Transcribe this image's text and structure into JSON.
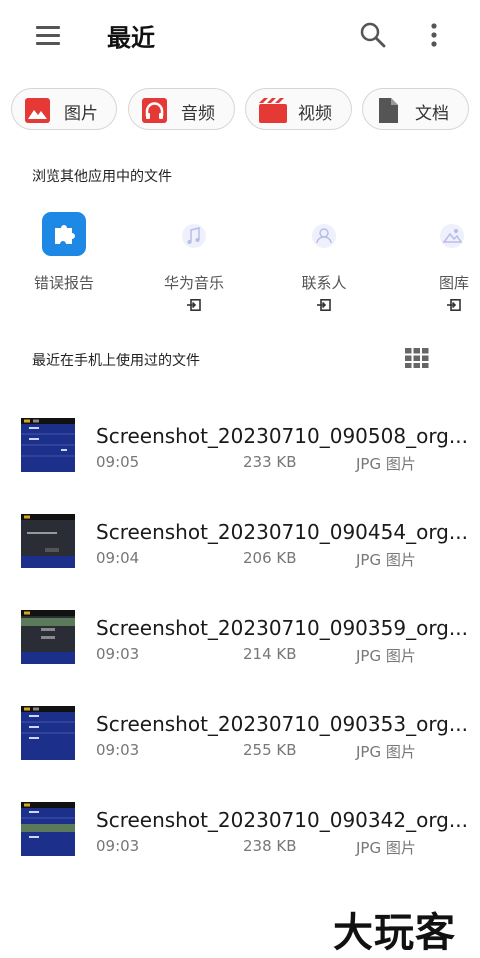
{
  "header": {
    "title": "最近"
  },
  "chips": [
    {
      "label": "图片",
      "icon": "image-icon",
      "color": "#e53935"
    },
    {
      "label": "音频",
      "icon": "headphones-icon",
      "color": "#e53935"
    },
    {
      "label": "视频",
      "icon": "video-icon",
      "color": "#e53935"
    },
    {
      "label": "文档",
      "icon": "document-icon",
      "color": "#555555"
    }
  ],
  "apps_section": {
    "title": "浏览其他应用中的文件",
    "apps": [
      {
        "label": "错误报告",
        "icon": "puzzle-icon",
        "accent": "#1e88e5"
      },
      {
        "label": "华为音乐",
        "icon": "music-app-icon"
      },
      {
        "label": "联系人",
        "icon": "contacts-app-icon"
      },
      {
        "label": "图库",
        "icon": "gallery-app-icon"
      }
    ]
  },
  "recent_section": {
    "title": "最近在手机上使用过的文件"
  },
  "files": [
    {
      "name": "Screenshot_20230710_090508_org....",
      "time": "09:05",
      "size": "233 KB",
      "type": "JPG 图片"
    },
    {
      "name": "Screenshot_20230710_090454_org....",
      "time": "09:04",
      "size": "206 KB",
      "type": "JPG 图片"
    },
    {
      "name": "Screenshot_20230710_090359_org....",
      "time": "09:03",
      "size": "214 KB",
      "type": "JPG 图片"
    },
    {
      "name": "Screenshot_20230710_090353_org....",
      "time": "09:03",
      "size": "255 KB",
      "type": "JPG 图片"
    },
    {
      "name": "Screenshot_20230710_090342_org....",
      "time": "09:03",
      "size": "238 KB",
      "type": "JPG 图片"
    }
  ],
  "watermark": "大玩客"
}
